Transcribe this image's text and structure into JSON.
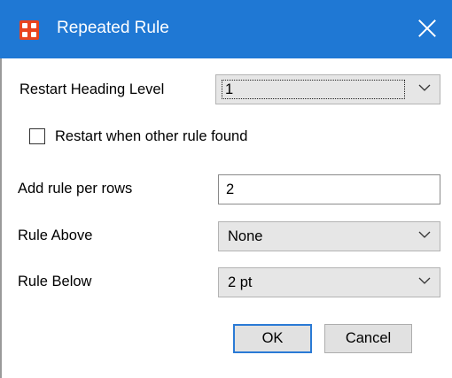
{
  "window": {
    "title": "Repeated Rule",
    "app_icon": "app-grid-icon",
    "close_icon": "close-icon",
    "accent": "#1f78d4"
  },
  "form": {
    "restart_heading_level": {
      "label": "Restart Heading Level",
      "value": "1"
    },
    "restart_when_other_rule": {
      "label": "Restart when other rule found",
      "checked": false
    },
    "add_rule_per_rows": {
      "label": "Add rule per rows",
      "value": "2"
    },
    "rule_above": {
      "label": "Rule Above",
      "value": "None"
    },
    "rule_below": {
      "label": "Rule Below",
      "value": "2 pt"
    }
  },
  "buttons": {
    "ok": "OK",
    "cancel": "Cancel"
  }
}
